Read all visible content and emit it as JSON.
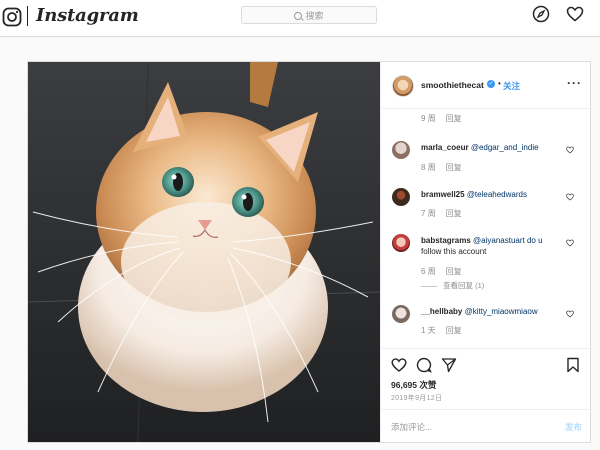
{
  "nav": {
    "logo_text": "Instagram",
    "search_placeholder": "搜索",
    "icons": [
      "instagram-glyph-icon",
      "search-icon",
      "compass-icon",
      "heart-icon"
    ]
  },
  "post": {
    "username": "smoothiethecat",
    "follow_label": "关注",
    "first_meta": {
      "time": "9 周",
      "reply": "回复"
    },
    "comments": [
      {
        "user": "marla_coeur",
        "text": "@edgar_and_indie",
        "time": "8 周",
        "reply": "回复"
      },
      {
        "user": "bramwell25",
        "text": "@teleahedwards",
        "time": "7 周",
        "reply": "回复"
      },
      {
        "user": "babstagrams",
        "text": "@aiyanastuart do u",
        "text2": "follow this account",
        "time": "6 周",
        "reply": "回复",
        "view_replies": "查看回复 (1)"
      },
      {
        "user": "__hellbaby",
        "text": "@kitty_miaowmiaow",
        "time": "1 天",
        "reply": "回复"
      }
    ],
    "likes": "96,695 次赞",
    "date": "2019年9月12日",
    "add_comment_placeholder": "添加评论...",
    "post_label": "发布"
  },
  "colors": {
    "link_blue": "#3897f0",
    "border": "#dbdbdb",
    "muted": "#8e8e8e"
  }
}
